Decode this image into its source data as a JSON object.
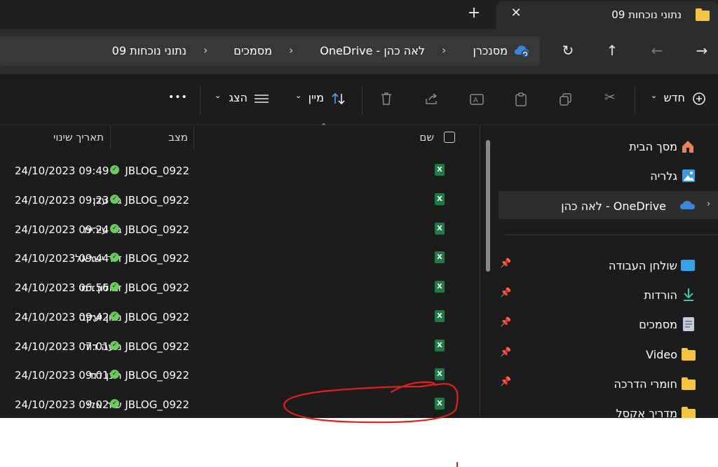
{
  "window": {
    "tab_title": "נתוני  נוכחות 09",
    "new_tab_glyph": "+",
    "close_glyph": "✕"
  },
  "address": {
    "crumbs": [
      "מסנכרן",
      "לאה כהן - OneDrive",
      "מסמכים",
      "נתוני  נוכחות 09"
    ]
  },
  "toolbar": {
    "new_label": "חדש",
    "sort_label": "מיין",
    "view_label": "הצג",
    "more_glyph": "•••"
  },
  "columns": {
    "name": "שם",
    "status": "מצב",
    "modified": "תאריך שינוי"
  },
  "files": [
    {
      "name": "JBLOG_0922",
      "date": "24/10/2023 09:49"
    },
    {
      "name": "JBLOG_0922 גל עדן",
      "date": "24/10/2023 09:23"
    },
    {
      "name": "JBLOG_0922 גל עירית",
      "date": "24/10/2023 09:24"
    },
    {
      "name": "JBLOG_0922 דור ישראל",
      "date": "24/10/2023 09:44"
    },
    {
      "name": "JBLOG_0922 זבולון רמי",
      "date": "24/10/2023 06:56"
    },
    {
      "name": "JBLOG_0922 נבון יעקב",
      "date": "24/10/2023 09:42"
    },
    {
      "name": "JBLOG_0922 נועה דוד",
      "date": "24/10/2023 07:01"
    },
    {
      "name": "JBLOG_0922 רונן דוד",
      "date": "24/10/2023 09:01"
    },
    {
      "name": "JBLOG_0922 שיר אלי",
      "date": "24/10/2023 09:02"
    }
  ],
  "sidebar": {
    "items": [
      {
        "label": "מסך הבית"
      },
      {
        "label": "גלריה"
      },
      {
        "label": "OneDrive - לאה כהן"
      },
      {
        "label": "שולחן העבודה"
      },
      {
        "label": "הורדות"
      },
      {
        "label": "מסמכים"
      },
      {
        "label": "Video"
      },
      {
        "label": "חומרי הדרכה"
      },
      {
        "label": "מדריך אקסל"
      }
    ]
  },
  "colors": {
    "background": "#1c1c1c",
    "sync_ok": "#6ccb5f",
    "excel": "#1f7a45",
    "folder": "#f4c543",
    "annotation": "#e0201c"
  },
  "icons": [
    "folder-icon",
    "sync-cloud-icon",
    "refresh-icon",
    "up-arrow-icon",
    "back-arrow-icon",
    "forward-arrow-icon",
    "plus-circle-icon",
    "cut-icon",
    "copy-icon",
    "paste-icon",
    "rename-icon",
    "share-icon",
    "delete-icon",
    "sort-icon",
    "view-lines-icon",
    "excel-file-icon",
    "synced-check-icon",
    "home-icon",
    "gallery-icon",
    "onedrive-cloud-icon",
    "desktop-icon",
    "download-icon",
    "document-icon",
    "pin-icon"
  ]
}
